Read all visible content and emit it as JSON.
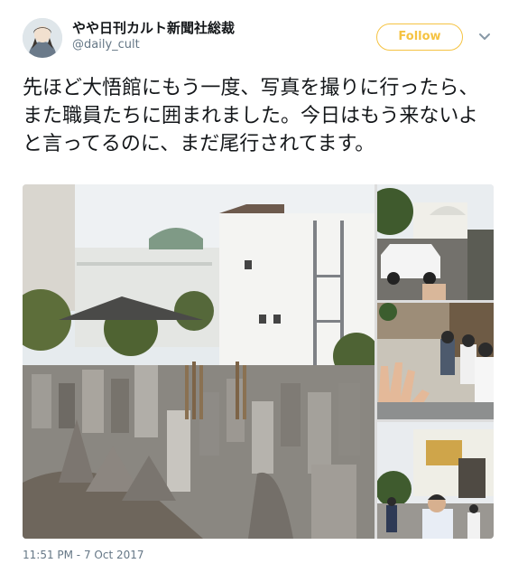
{
  "tweet": {
    "display_name": "やや日刊カルト新聞社総裁",
    "handle": "@daily_cult",
    "follow_label": "Follow",
    "text": "先ほど大悟館にもう一度、写真を撮りに行ったら、また職員たちに囲まれました。今日はもう来ないよと言ってるのに、まだ尾行されてます。",
    "timestamp": "11:51 PM - 7 Oct 2017"
  },
  "colors": {
    "follow_accent": "#f5c342",
    "text": "#14171a",
    "muted": "#657786"
  },
  "icons": {
    "more": "chevron-down-icon"
  }
}
